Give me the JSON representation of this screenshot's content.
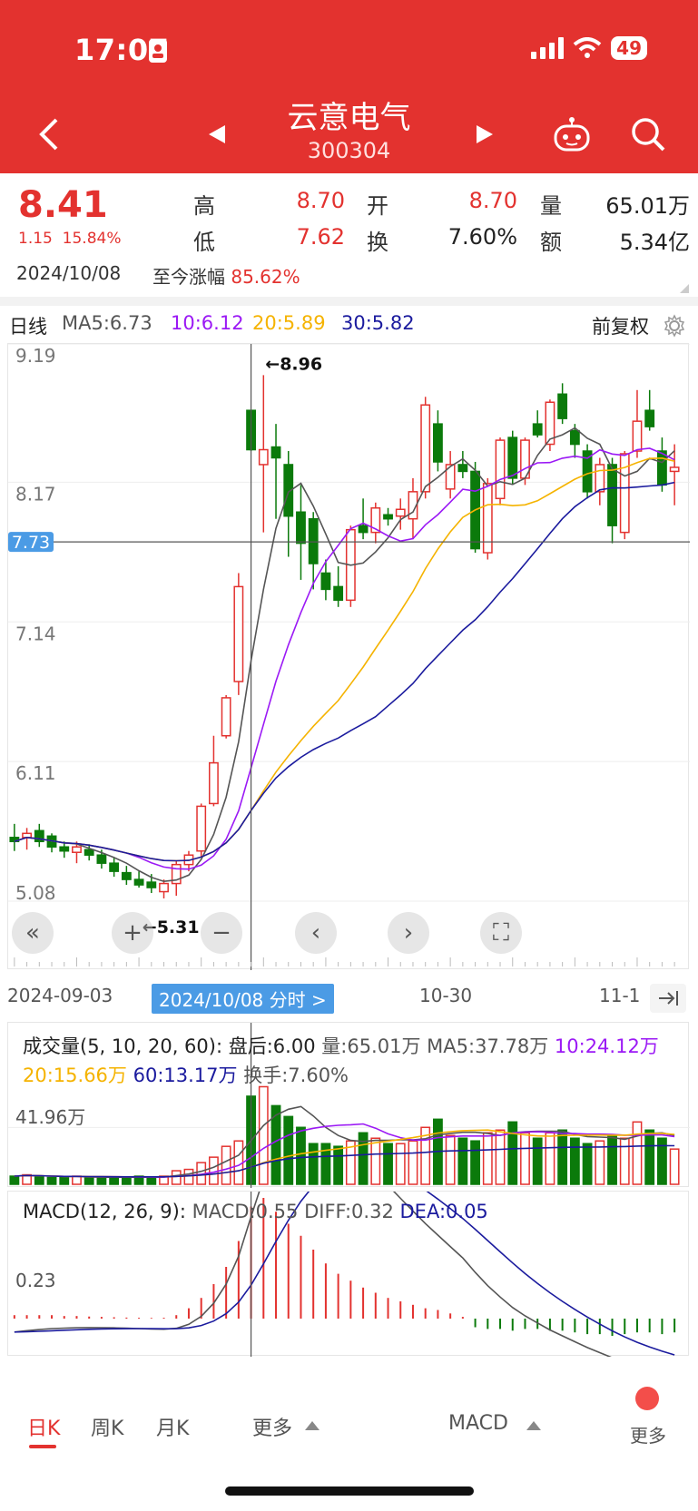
{
  "status": {
    "time": "17:07",
    "battery": "49"
  },
  "header": {
    "title": "云意电气",
    "code": "300304"
  },
  "quote": {
    "price": "8.41",
    "change": "1.15",
    "change_pct": "15.84%",
    "date": "2024/10/08",
    "since_label": "至今涨幅",
    "since_value": "85.62%",
    "high_label": "高",
    "high": "8.70",
    "low_label": "低",
    "low": "7.62",
    "open_label": "开",
    "open": "8.70",
    "turnover_label": "换",
    "turnover": "7.60%",
    "vol_label": "量",
    "vol": "65.01万",
    "amount_label": "额",
    "amount": "5.34亿"
  },
  "ma_bar": {
    "period": "日线",
    "ma5": "MA5:6.73",
    "ma10": "10:6.12",
    "ma20": "20:5.89",
    "ma30": "30:5.82",
    "adjust": "前复权"
  },
  "colors": {
    "up": "#e3322f",
    "down": "#0b7a0b",
    "ma5": "#555555",
    "ma10": "#9b19f5",
    "ma20": "#f5b300",
    "ma30": "#1b1b9e",
    "accent": "#4b9be5"
  },
  "chart_data": [
    {
      "type": "candlestick",
      "y_ticks": [
        "9.19",
        "8.17",
        "7.14",
        "6.11",
        "5.08"
      ],
      "ylim": [
        5.08,
        9.19
      ],
      "crosshair_price": "7.73",
      "max_label": "←8.96",
      "min_label": "←5.31",
      "x_ticks": [
        "2024-09-03",
        "10-30",
        "11-1"
      ],
      "selected_date_label": "2024/10/08 分时 >",
      "candles": [
        [
          5.55,
          5.65,
          5.45,
          5.52
        ],
        [
          5.55,
          5.62,
          5.46,
          5.58
        ],
        [
          5.6,
          5.65,
          5.48,
          5.52
        ],
        [
          5.56,
          5.58,
          5.44,
          5.48
        ],
        [
          5.48,
          5.52,
          5.4,
          5.45
        ],
        [
          5.44,
          5.52,
          5.36,
          5.48
        ],
        [
          5.46,
          5.5,
          5.38,
          5.42
        ],
        [
          5.42,
          5.46,
          5.32,
          5.36
        ],
        [
          5.36,
          5.4,
          5.26,
          5.3
        ],
        [
          5.29,
          5.34,
          5.2,
          5.24
        ],
        [
          5.24,
          5.3,
          5.18,
          5.2
        ],
        [
          5.22,
          5.28,
          5.14,
          5.18
        ],
        [
          5.15,
          5.24,
          5.1,
          5.21
        ],
        [
          5.21,
          5.38,
          5.12,
          5.35
        ],
        [
          5.35,
          5.45,
          5.3,
          5.42
        ],
        [
          5.45,
          5.8,
          5.4,
          5.78
        ],
        [
          5.8,
          6.3,
          5.78,
          6.1
        ],
        [
          6.3,
          6.6,
          6.28,
          6.58
        ],
        [
          6.7,
          7.5,
          6.6,
          7.4
        ],
        [
          8.7,
          8.7,
          8.4,
          8.41
        ],
        [
          8.3,
          8.96,
          7.8,
          8.41
        ],
        [
          8.43,
          8.6,
          7.9,
          8.35
        ],
        [
          8.3,
          8.4,
          7.62,
          7.92
        ],
        [
          7.95,
          8.15,
          7.45,
          7.72
        ],
        [
          7.9,
          7.95,
          7.38,
          7.57
        ],
        [
          7.5,
          7.6,
          7.3,
          7.38
        ],
        [
          7.4,
          7.55,
          7.25,
          7.3
        ],
        [
          7.3,
          7.85,
          7.25,
          7.82
        ],
        [
          7.85,
          8.05,
          7.75,
          7.8
        ],
        [
          7.8,
          8.02,
          7.72,
          7.98
        ],
        [
          7.93,
          7.98,
          7.85,
          7.9
        ],
        [
          7.92,
          8.05,
          7.82,
          7.97
        ],
        [
          7.9,
          8.2,
          7.75,
          8.1
        ],
        [
          8.1,
          8.8,
          8.05,
          8.74
        ],
        [
          8.6,
          8.7,
          8.25,
          8.32
        ],
        [
          8.12,
          8.4,
          8.05,
          8.3
        ],
        [
          8.3,
          8.4,
          8.2,
          8.25
        ],
        [
          8.25,
          8.32,
          7.65,
          7.68
        ],
        [
          7.65,
          8.2,
          7.6,
          8.16
        ],
        [
          8.05,
          8.5,
          8.0,
          8.48
        ],
        [
          8.5,
          8.55,
          8.15,
          8.2
        ],
        [
          8.2,
          8.5,
          8.15,
          8.48
        ],
        [
          8.6,
          8.7,
          8.5,
          8.52
        ],
        [
          8.45,
          8.78,
          8.4,
          8.76
        ],
        [
          8.82,
          8.9,
          8.6,
          8.64
        ],
        [
          8.55,
          8.6,
          8.35,
          8.45
        ],
        [
          8.4,
          8.45,
          8.05,
          8.1
        ],
        [
          8.1,
          8.35,
          8.0,
          8.3
        ],
        [
          8.3,
          8.35,
          7.72,
          7.85
        ],
        [
          7.8,
          8.4,
          7.75,
          8.38
        ],
        [
          8.4,
          8.85,
          8.35,
          8.62
        ],
        [
          8.7,
          8.85,
          8.55,
          8.58
        ],
        [
          8.4,
          8.5,
          8.1,
          8.15
        ],
        [
          8.25,
          8.45,
          8.0,
          8.28
        ]
      ]
    },
    {
      "type": "bar",
      "title": "成交量(5, 10, 20, 60):",
      "legend": [
        "盘后:6.00",
        "量:65.01万",
        "MA5:37.78万",
        "10:24.12万",
        "20:15.66万",
        "60:13.17万",
        "换手:7.60%"
      ],
      "y_tick": "41.96万",
      "values": [
        6,
        7,
        6,
        5,
        5,
        6,
        5,
        5,
        5,
        5,
        6,
        5,
        6,
        10,
        11,
        16,
        20,
        28,
        32,
        65,
        72,
        58,
        50,
        42,
        30,
        30,
        28,
        32,
        38,
        34,
        30,
        30,
        32,
        42,
        48,
        36,
        34,
        32,
        38,
        40,
        46,
        38,
        34,
        38,
        40,
        34,
        30,
        32,
        36,
        34,
        46,
        40,
        34,
        26
      ]
    },
    {
      "type": "bar",
      "title": "MACD(12, 26, 9):",
      "legend": [
        "MACD:0.55",
        "DIFF:0.32",
        "DEA:0.05"
      ],
      "y_tick": "0.23",
      "values": [
        0.02,
        0.02,
        0.02,
        0.02,
        0.015,
        0.015,
        0.012,
        0.01,
        0.008,
        0.006,
        0.005,
        0.004,
        0.005,
        0.02,
        0.06,
        0.12,
        0.2,
        0.3,
        0.45,
        0.65,
        0.7,
        0.62,
        0.55,
        0.48,
        0.4,
        0.32,
        0.26,
        0.22,
        0.18,
        0.15,
        0.12,
        0.1,
        0.08,
        0.06,
        0.05,
        0.03,
        0.01,
        -0.05,
        -0.06,
        -0.06,
        -0.07,
        -0.06,
        -0.06,
        -0.07,
        -0.07,
        -0.08,
        -0.09,
        -0.09,
        -0.1,
        -0.09,
        -0.08,
        -0.08,
        -0.09,
        -0.08
      ]
    }
  ],
  "tabs": {
    "day": "日K",
    "week": "周K",
    "month": "月K",
    "more": "更多",
    "macd": "MACD",
    "more2": "更多"
  }
}
